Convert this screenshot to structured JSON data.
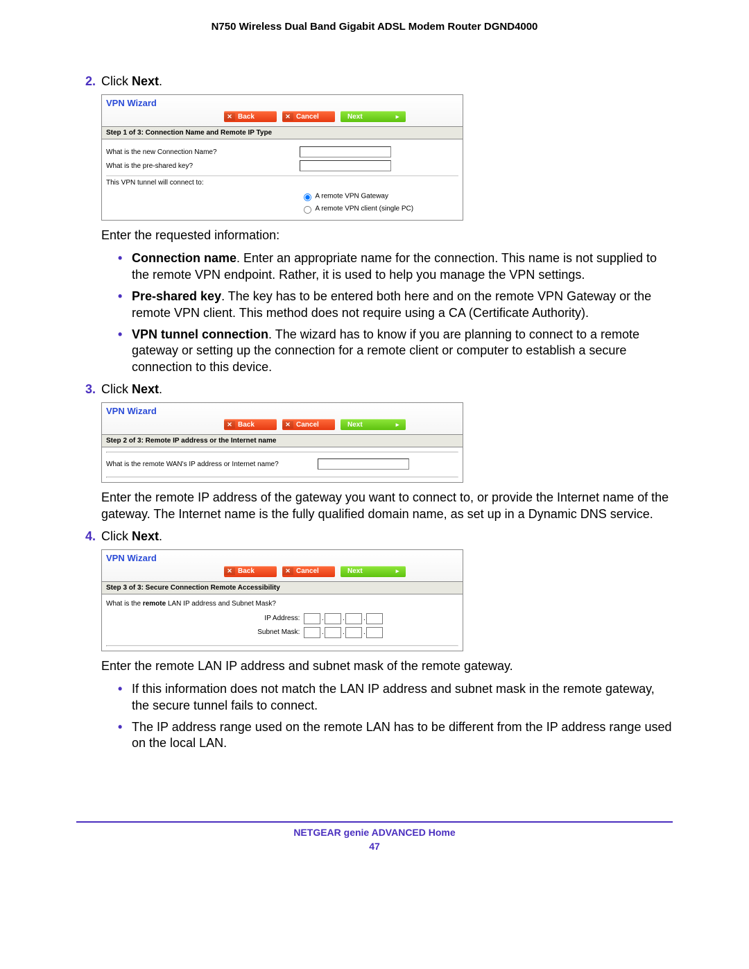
{
  "doc_header": "N750 Wireless Dual Band Gigabit ADSL Modem Router DGND4000",
  "steps": {
    "s2": {
      "num": "2.",
      "prefix": "Click ",
      "bold": "Next",
      "suffix": "."
    },
    "s3": {
      "num": "3.",
      "prefix": "Click ",
      "bold": "Next",
      "suffix": "."
    },
    "s4": {
      "num": "4.",
      "prefix": "Click ",
      "bold": "Next",
      "suffix": "."
    }
  },
  "wizard": {
    "title": "VPN Wizard",
    "buttons": {
      "back_x": "✕",
      "back": "Back",
      "cancel_x": "✕",
      "cancel": "Cancel",
      "next": "Next",
      "next_arrow": "▸"
    },
    "w1": {
      "step": "Step 1 of 3: Connection Name and Remote IP Type",
      "q_name": "What is the new Connection Name?",
      "q_psk": "What is the pre-shared key?",
      "q_connect": "This VPN tunnel will connect to:",
      "opt_gateway": "A remote VPN Gateway",
      "opt_client": "A remote VPN client (single PC)"
    },
    "w2": {
      "step": "Step 2 of 3: Remote IP address or the Internet name",
      "q": "What is the remote WAN's IP address or Internet name?"
    },
    "w3": {
      "step": "Step 3 of 3: Secure Connection Remote Accessibility",
      "q_prefix": "What is the ",
      "q_bold": "remote",
      "q_suffix": " LAN IP address and Subnet Mask?",
      "ip_label": "IP Address:",
      "mask_label": "Subnet Mask:"
    }
  },
  "para": {
    "after_w1_intro": "Enter the requested information:",
    "after_w2": "Enter the remote IP address of the gateway you want to connect to, or provide the Internet name of the gateway. The Internet name is the fully qualified domain name, as set up in a Dynamic DNS service.",
    "after_w3_intro": "Enter the remote LAN IP address and subnet mask of the remote gateway."
  },
  "bullets_after_w1": [
    {
      "bold": "Connection name",
      "text": ". Enter an appropriate name for the connection. This name is not supplied to the remote VPN endpoint. Rather, it is used to help you manage the VPN settings."
    },
    {
      "bold": "Pre-shared key",
      "text": ". The key has to be entered both here and on the remote VPN Gateway or the remote VPN client. This method does not require using a CA (Certificate Authority)."
    },
    {
      "bold": "VPN tunnel connection",
      "text": ". The wizard has to know if you are planning to connect to a remote gateway or setting up the connection for a remote client or computer to establish a secure connection to this device."
    }
  ],
  "bullets_after_w3": [
    {
      "text": "If this information does not match the LAN IP address and subnet mask in the remote gateway, the secure tunnel fails to connect."
    },
    {
      "text": "The IP address range used on the remote LAN has to be different from the IP address range used on the local LAN."
    }
  ],
  "footer": {
    "line": "NETGEAR genie ADVANCED Home",
    "page": "47"
  }
}
